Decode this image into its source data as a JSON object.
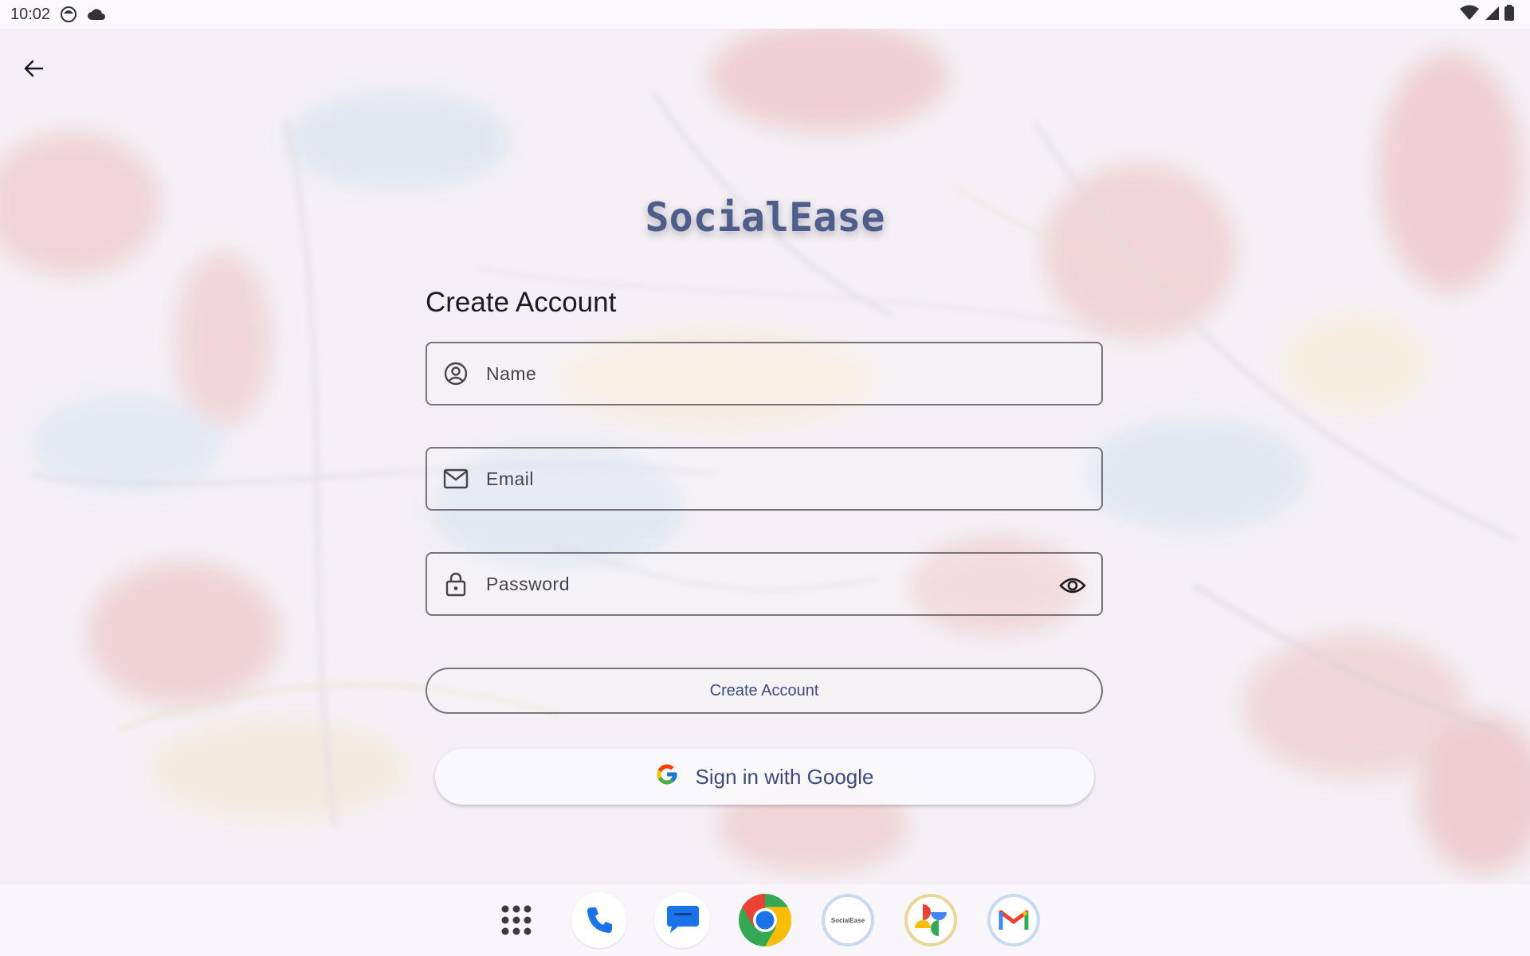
{
  "status_bar": {
    "time": "10:02"
  },
  "app": {
    "name": "SocialEase"
  },
  "form": {
    "heading": "Create Account",
    "name_placeholder": "Name",
    "email_placeholder": "Email",
    "password_placeholder": "Password",
    "submit_label": "Create Account",
    "google_label": "Sign in with Google"
  },
  "dock": {
    "items": [
      "app-drawer",
      "phone",
      "messages",
      "chrome",
      "socialease",
      "photos",
      "gmail"
    ],
    "socialease_label": "SocialEase"
  },
  "colors": {
    "accent": "#3d4a7b",
    "logo": "#4e5d8a",
    "outline": "#77747c"
  }
}
